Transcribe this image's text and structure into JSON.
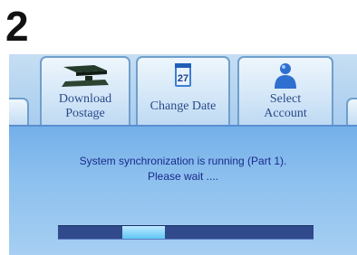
{
  "step_number": "2",
  "tabs": [
    {
      "label_line1": "Download",
      "label_line2": "Postage",
      "icon": "scale-icon"
    },
    {
      "label_line1": "Change Date",
      "label_line2": "",
      "icon": "calendar-icon"
    },
    {
      "label_line1": "Select",
      "label_line2": "Account",
      "icon": "person-icon"
    }
  ],
  "message": {
    "line1": "System synchronization is running (Part 1).",
    "line2": "Please wait ...."
  },
  "progress": {
    "indicator_start": 0.25,
    "indicator_end": 0.42
  },
  "colors": {
    "accent": "#2a4a8a",
    "progress_track": "#304a8c",
    "progress_indicator": "#5fc6f4"
  }
}
